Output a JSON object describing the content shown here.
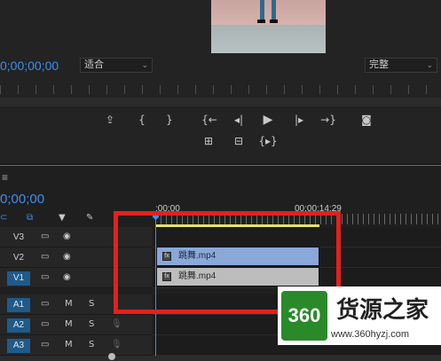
{
  "program_monitor": {
    "timecode": "0;00;00;00",
    "fit_dropdown": "适合",
    "quality_dropdown": "完整",
    "controls": [
      {
        "icon": "add-marker-icon",
        "glyph": "⬆"
      },
      {
        "icon": "mark-in-icon",
        "glyph": "{"
      },
      {
        "icon": "mark-out-icon",
        "glyph": "}"
      },
      {
        "icon": "go-to-in-icon",
        "glyph": "{←"
      },
      {
        "icon": "step-back-icon",
        "glyph": "◀|"
      },
      {
        "icon": "play-icon",
        "glyph": "▶"
      },
      {
        "icon": "step-forward-icon",
        "glyph": "|▶"
      },
      {
        "icon": "go-to-out-icon",
        "glyph": "→}"
      },
      {
        "icon": "camera-icon",
        "glyph": "◙"
      },
      {
        "icon": "lift-icon",
        "glyph": "⊞"
      },
      {
        "icon": "extract-icon",
        "glyph": "⊟"
      },
      {
        "icon": "trim-icon",
        "glyph": "{▸}"
      }
    ]
  },
  "timeline": {
    "menu_glyph": "≡",
    "timecode": "0;00;00",
    "ruler_start": ":00:00",
    "ruler_mark": "00:00:14:29",
    "tracks": [
      {
        "name": "V3",
        "type": "video",
        "active": false
      },
      {
        "name": "V2",
        "type": "video",
        "active": false
      },
      {
        "name": "V1",
        "type": "video",
        "active": true
      },
      {
        "name": "A1",
        "type": "audio",
        "active": true
      },
      {
        "name": "A2",
        "type": "audio",
        "active": true
      },
      {
        "name": "A3",
        "type": "audio",
        "active": true
      }
    ],
    "mute_label": "M",
    "solo_label": "S",
    "clips": {
      "video": "跳舞.mp4",
      "audio": "跳舞.mp4"
    }
  },
  "watermark": {
    "badge": "360",
    "name": "货源之家",
    "url": "www.360hyzj.com"
  },
  "colors": {
    "timecode_blue": "#3f8ef0",
    "highlight_red": "#e0221c",
    "video_clip": "#8aa8d8",
    "audio_clip": "#bdbdbd",
    "work_area": "#e7e36a"
  }
}
